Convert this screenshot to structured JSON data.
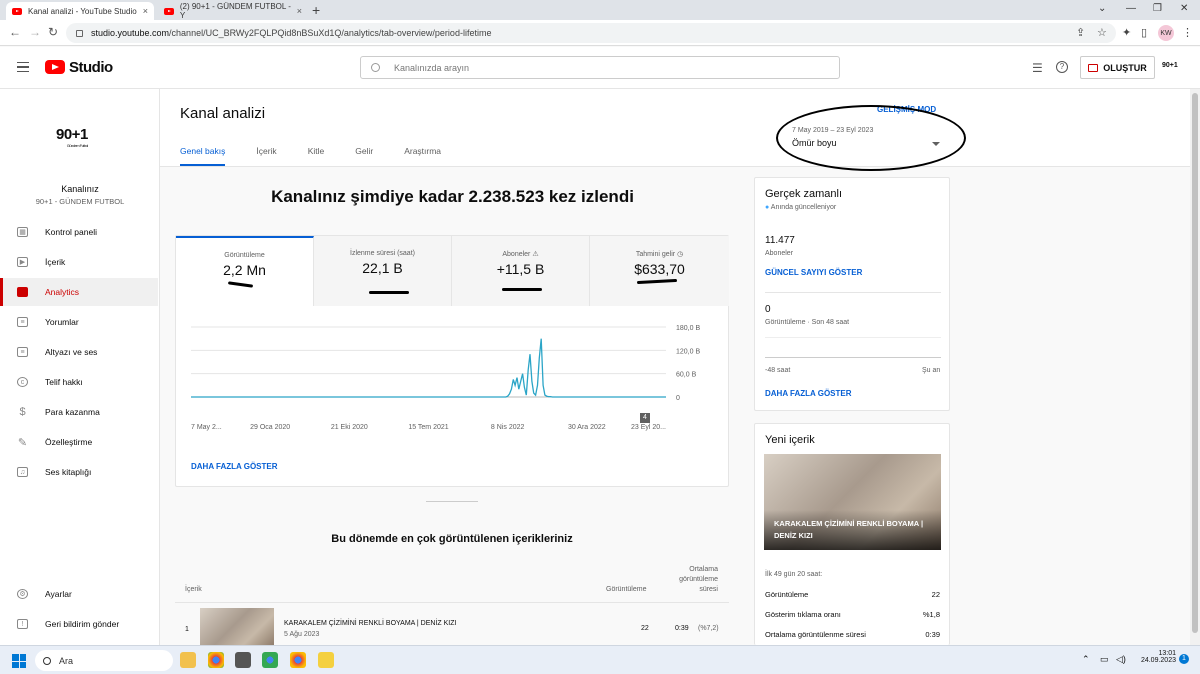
{
  "browser": {
    "tabs": [
      {
        "title": "Kanal analizi - YouTube Studio",
        "close": "×"
      },
      {
        "title": "(2) 90+1 - GÜNDEM FUTBOL - Y",
        "close": "×"
      }
    ],
    "new_tab": "+",
    "address_host": "studio.youtube.com",
    "address_path": "/channel/UC_BRWy2FQLPQid8nBSuXd1Q/analytics/tab-overview/period-lifetime",
    "profile_initials": "KW"
  },
  "header": {
    "logo_text": "Studio",
    "search_placeholder": "Kanalınızda arayın",
    "create_label": "OLUŞTUR",
    "channel_avatar_text": "90+1"
  },
  "sidebar": {
    "channel_logo": "90+1",
    "channel_logo_sub": "Gündem Futbol",
    "channel_label": "Kanalınız",
    "channel_name": "90+1 - GÜNDEM FUTBOL",
    "items": [
      {
        "label": "Kontrol paneli",
        "icon": "dashboard-icon"
      },
      {
        "label": "İçerik",
        "icon": "content-icon"
      },
      {
        "label": "Analytics",
        "icon": "analytics-icon",
        "active": true
      },
      {
        "label": "Yorumlar",
        "icon": "comments-icon"
      },
      {
        "label": "Altyazı ve ses",
        "icon": "subtitles-icon"
      },
      {
        "label": "Telif hakkı",
        "icon": "copyright-icon"
      },
      {
        "label": "Para kazanma",
        "icon": "monetization-icon"
      },
      {
        "label": "Özelleştirme",
        "icon": "customization-icon"
      },
      {
        "label": "Ses kitaplığı",
        "icon": "audio-library-icon"
      }
    ],
    "footer_items": [
      {
        "label": "Ayarlar",
        "icon": "settings-icon"
      },
      {
        "label": "Geri bildirim gönder",
        "icon": "feedback-icon"
      }
    ]
  },
  "page": {
    "title": "Kanal analizi",
    "tabs": [
      "Genel bakış",
      "İçerik",
      "Kitle",
      "Gelir",
      "Araştırma"
    ],
    "advanced_mode": "GELİŞMİŞ MOD",
    "date_range": "7 May 2019 – 23 Eyl 2023",
    "period": "Ömür boyu"
  },
  "overview": {
    "headline": "Kanalınız şimdiye kadar 2.238.523 kez izlendi",
    "metrics": [
      {
        "label": "Görüntüleme",
        "value": "2,2 Mn"
      },
      {
        "label": "İzlenme süresi (saat)",
        "value": "22,1 B"
      },
      {
        "label": "Aboneler",
        "value": "+11,5 B"
      },
      {
        "label": "Tahmini gelir",
        "value": "$633,70"
      }
    ],
    "chart_badge": "4",
    "show_more": "DAHA FAZLA GÖSTER"
  },
  "chart_data": {
    "type": "line",
    "title": "",
    "xlabel": "",
    "ylabel": "",
    "x_tick_labels": [
      "7 May 2...",
      "29 Oca 2020",
      "21 Eki 2020",
      "15 Tem 2021",
      "8 Nis 2022",
      "30 Ara 2022",
      "23 Eyl 20..."
    ],
    "y_tick_labels": [
      "180,0 B",
      "120,0 B",
      "60,0 B",
      "0"
    ],
    "ylim": [
      0,
      180000
    ],
    "grid": true,
    "series": [
      {
        "values": [
          0,
          0,
          0,
          0,
          0,
          0,
          0,
          0,
          0,
          0,
          0,
          0,
          0,
          0,
          0,
          0,
          0,
          0,
          0,
          0,
          0,
          0,
          0,
          0,
          0,
          0,
          0,
          0,
          0,
          0,
          0,
          0,
          0,
          0,
          0,
          0,
          0,
          0,
          0,
          0,
          0,
          0,
          0,
          0,
          0,
          0,
          0,
          0,
          0,
          0,
          0,
          0,
          0,
          0,
          0,
          0,
          0,
          0,
          0,
          0,
          0,
          0,
          0,
          0,
          0,
          0,
          0,
          0,
          0,
          0,
          0,
          0,
          0,
          0,
          0,
          0,
          0,
          0,
          0,
          0,
          0,
          0,
          0,
          0,
          0,
          0,
          0,
          0,
          0,
          0,
          0,
          0,
          0,
          0,
          0,
          0,
          0,
          0,
          0,
          0,
          0,
          0,
          0,
          0,
          0,
          0,
          0,
          0,
          0,
          0,
          0,
          0,
          0,
          0,
          0,
          0,
          0,
          0,
          0,
          0,
          0,
          0,
          0,
          0,
          0,
          0,
          0,
          0,
          0,
          0,
          0,
          0,
          0,
          0,
          0,
          0,
          0,
          0,
          0,
          0,
          0,
          0,
          0,
          0,
          0,
          0,
          0,
          0,
          0,
          0,
          0,
          0,
          0,
          0,
          0,
          0,
          0,
          0,
          0,
          0,
          0,
          0,
          0,
          0,
          0,
          0,
          0,
          0,
          0,
          0,
          2000,
          8000,
          20000,
          45000,
          30000,
          50000,
          20000,
          40000,
          60000,
          25000,
          5000,
          70000,
          110000,
          40000,
          10000,
          5000,
          30000,
          100000,
          150000,
          30000,
          5000,
          2000,
          1000,
          1000,
          0,
          0,
          0,
          0,
          0,
          0,
          0,
          0,
          0,
          0,
          0,
          0,
          0,
          0,
          0,
          0,
          0,
          0,
          0,
          0,
          0,
          0,
          0,
          0,
          0,
          0,
          0,
          0,
          0,
          0,
          0,
          0,
          0,
          0,
          0,
          0,
          0,
          0,
          0,
          0,
          0,
          0,
          0,
          0,
          0,
          0,
          0,
          0,
          0,
          0,
          0,
          0,
          0,
          0,
          0,
          0,
          0,
          0,
          0,
          0,
          0,
          0
        ]
      }
    ]
  },
  "content_table": {
    "title": "Bu dönemde en çok görüntülenen içerikleriniz",
    "col_content": "İçerik",
    "col_views": "Görüntüleme",
    "col_avg": "Ortalama görüntüleme süresi",
    "rows": [
      {
        "rank": "1",
        "title": "KARAKALEM ÇİZİMİNİ RENKLİ BOYAMA | DENİZ KIZI",
        "date": "5 Ağu 2023",
        "views": "22",
        "avg": "0:39",
        "avg_pct": "(%7,2)"
      }
    ]
  },
  "realtime": {
    "title": "Gerçek zamanlı",
    "status": "Anında güncelleniyor",
    "subs_value": "11.477",
    "subs_label": "Aboneler",
    "subs_link": "GÜNCEL SAYIYI GÖSTER",
    "views_value": "0",
    "views_label": "Görüntüleme · Son 48 saat",
    "axis_left": "-48 saat",
    "axis_right": "Şu an",
    "more_link": "DAHA FAZLA GÖSTER"
  },
  "latest": {
    "title": "Yeni içerik",
    "video_title": "KARAKALEM ÇİZİMİNİ RENKLİ BOYAMA | DENİZ KIZI",
    "period": "İlk 49 gün 20 saat:",
    "stats": [
      {
        "label": "Görüntüleme",
        "value": "22"
      },
      {
        "label": "Gösterim tıklama oranı",
        "value": "%1,8"
      },
      {
        "label": "Ortalama görüntülenme süresi",
        "value": "0:39"
      }
    ]
  },
  "taskbar": {
    "search": "Ara",
    "time": "13:01",
    "date": "24.09.2023",
    "notif": "1"
  }
}
